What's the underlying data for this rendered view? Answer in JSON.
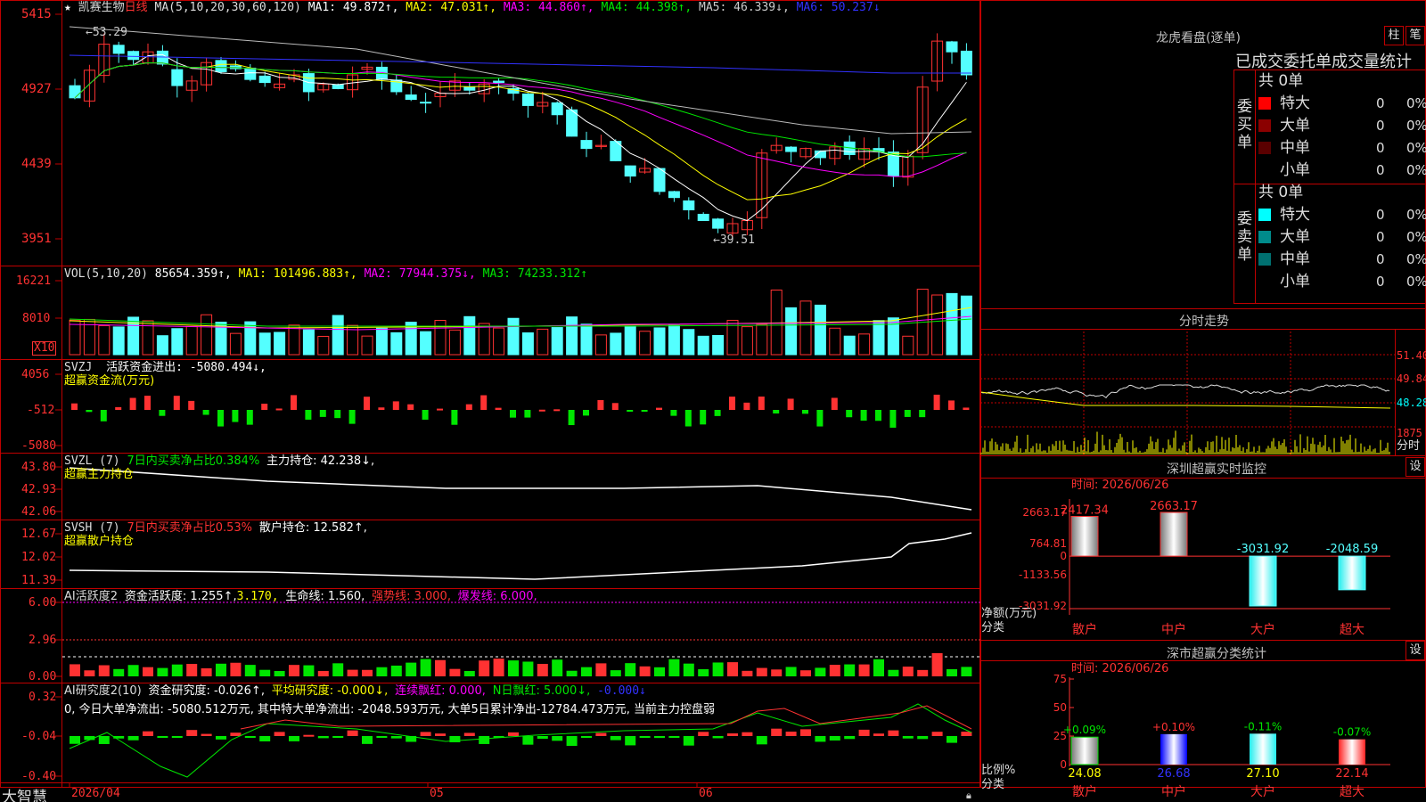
{
  "colors": {
    "up": "#ff3232",
    "down": "#54ffff",
    "grid": "#c00000",
    "ma1": "#ffffff",
    "ma2": "#ffff00",
    "ma3": "#ff00ff",
    "ma4": "#00e600",
    "ma5": "#bbbbbb",
    "ma6": "#3232ff",
    "accent_yellow": "#ffff00"
  },
  "header": {
    "star": "★",
    "stock_name": "凯赛生物",
    "period": "日线",
    "ma_params": "MA(5,10,20,30,60,120)",
    "ma1": "MA1: 49.872↑,",
    "ma2": "MA2: 47.031↑,",
    "ma3": "MA3: 44.860↑,",
    "ma4": "MA4: 44.398↑,",
    "ma5": "MA5: 46.339↓,",
    "ma6": "MA6: 50.237↓"
  },
  "price_axis": [
    "5415",
    "4927",
    "4439",
    "3951"
  ],
  "annotations": {
    "high": "←53.29",
    "low": "←39.51"
  },
  "volume_panel": {
    "title": "VOL(5,10,20)",
    "value": "85654.359↑,",
    "ma1": "MA1: 101496.883↑,",
    "ma2": "MA2: 77944.375↓,",
    "ma3": "MA3: 74233.312↑",
    "axis": [
      "16221",
      "8010"
    ],
    "unit": "X10"
  },
  "svzj_panel": {
    "title": "SVZJ",
    "text": "活跃资金进出: -5080.494↓,",
    "sub": "超赢资金流(万元)",
    "axis": [
      "4056",
      "-512",
      "-5080"
    ]
  },
  "svzl_panel": {
    "title": "SVZL (7)",
    "pct": "7日内买卖净占比0.384%",
    "hold": "主力持仓: 42.238↓,",
    "sub": "超赢主力持仓",
    "axis": [
      "43.80",
      "42.93",
      "42.06"
    ]
  },
  "svsh_panel": {
    "title": "SVSH (7)",
    "pct": "7日内买卖净占比0.53%",
    "hold": "散户持仓: 12.582↑,",
    "sub": "超赢散户持仓",
    "axis": [
      "12.67",
      "12.02",
      "11.39"
    ]
  },
  "ai_active_panel": {
    "title": "AI活跃度2",
    "a": "资金活跃度: 1.255↑,",
    "b": "3.170,",
    "c": "生命线: 1.560,",
    "d": "强势线: 3.000,",
    "e": "爆发线: 6.000,",
    "axis": [
      "6.00",
      "2.96",
      "0.00"
    ]
  },
  "ai_research_panel": {
    "title": "AI研究度2(10)",
    "a": "资金研究度: -0.026↑,",
    "b": "平均研究度: -0.000↓,",
    "c": "连续飘红: 0.000,",
    "d": "N日飘红: 5.000↓,",
    "e": "-0.000↓",
    "desc": "0, 今日大单净流出: -5080.512万元, 其中特大单净流出: -2048.593万元, 大单5日累计净出-12784.473万元, 当前主力控盘弱",
    "axis": [
      "0.32",
      "-0.04",
      "-0.40"
    ]
  },
  "date_axis": {
    "brand": "大智慧",
    "d1": "2026/04",
    "d2": "05",
    "d3": "06"
  },
  "right_panel": {
    "lhb_title": "龙虎看盘(逐单)",
    "btn_zhu": "柱",
    "btn_bi": "笔",
    "tabs": "已成交委托单成交量统计",
    "buy_label": "委买单",
    "sell_label": "委卖单",
    "buy_total": "共 0单",
    "sell_total": "共 0单",
    "buy_rows": [
      {
        "name": "特大",
        "count": "0",
        "pct": "0%",
        "color": "#ff0000"
      },
      {
        "name": "大单",
        "count": "0",
        "pct": "0%",
        "color": "#8b0000"
      },
      {
        "name": "中单",
        "count": "0",
        "pct": "0%",
        "color": "#5a0000"
      },
      {
        "name": "小单",
        "count": "0",
        "pct": "0%",
        "color": "#000000"
      }
    ],
    "sell_rows": [
      {
        "name": "特大",
        "count": "0",
        "pct": "0%",
        "color": "#00ffff"
      },
      {
        "name": "大单",
        "count": "0",
        "pct": "0%",
        "color": "#008b8b"
      },
      {
        "name": "中单",
        "count": "0",
        "pct": "0%",
        "color": "#007070"
      },
      {
        "name": "小单",
        "count": "0",
        "pct": "0%",
        "color": "#000000"
      }
    ],
    "intraday_title": "分时走势",
    "intraday_axis": [
      "51.40",
      "49.84",
      "48.28",
      "1875"
    ],
    "intraday_unit": "分时",
    "monitor_title": "深圳超赢实时监控",
    "monitor_btn": "设",
    "monitor_date": "时间: 2026/06/26",
    "monitor_axis": [
      "2663.17",
      "764.81",
      "0",
      "-1133.56",
      "-3031.92"
    ],
    "monitor_ylabel": "净额(万元)",
    "monitor_xlabel": "分类",
    "stats_title": "深市超赢分类统计",
    "stats_btn": "设",
    "stats_date": "时间: 2026/06/26",
    "stats_axis": [
      "75",
      "50",
      "25",
      "0"
    ],
    "stats_ylabel": "比例%",
    "stats_xlabel": "分类"
  },
  "chart_data": [
    {
      "type": "bar",
      "title": "深圳超赢实时监控",
      "ylabel": "净额(万元)",
      "xlabel": "分类",
      "categories": [
        "散户",
        "中户",
        "大户",
        "超大"
      ],
      "values": [
        2417.34,
        2663.17,
        -3031.92,
        -2048.59
      ],
      "value_labels": [
        "2417.34",
        "2663.17",
        "-3031.92",
        "-2048.59"
      ],
      "ylim": [
        -3031.92,
        2663.17
      ]
    },
    {
      "type": "bar",
      "title": "深市超赢分类统计",
      "ylabel": "比例%",
      "xlabel": "分类",
      "categories": [
        "散户",
        "中户",
        "大户",
        "超大"
      ],
      "values": [
        24.08,
        26.68,
        27.1,
        22.14
      ],
      "change_labels": [
        "+0.09%",
        "+0.10%",
        "-0.11%",
        "-0.07%"
      ],
      "ylim": [
        0,
        75
      ]
    }
  ]
}
